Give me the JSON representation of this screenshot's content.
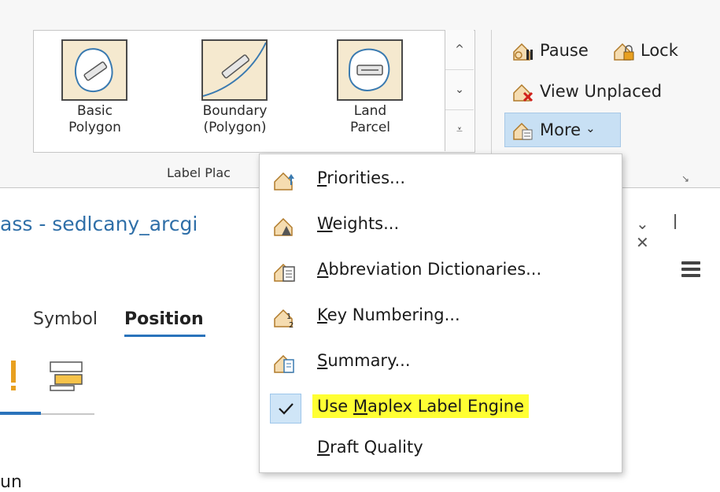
{
  "ribbon": {
    "gallery": [
      {
        "line1": "Basic",
        "line2": "Polygon"
      },
      {
        "line1": "Boundary",
        "line2": "(Polygon)"
      },
      {
        "line1": "Land",
        "line2": "Parcel"
      }
    ],
    "scroll_up": "^",
    "scroll_down": "⌄",
    "scroll_expand": "⩡",
    "group_label": "Label Plac",
    "pause_label": "Pause",
    "lock_label": "Lock",
    "view_unplaced_label": "View Unplaced",
    "more_label": "More",
    "more_caret": "⌄",
    "launcher": "↘"
  },
  "pane": {
    "title": "ass - sedlcany_arcgi",
    "controls": "⌄ ꟾ ✕",
    "tab_symbol": "Symbol",
    "tab_position": "Position",
    "bottom_text": "un"
  },
  "menu": {
    "items": [
      {
        "pre": "",
        "key": "P",
        "post": "riorities..."
      },
      {
        "pre": "",
        "key": "W",
        "post": "eights..."
      },
      {
        "pre": "",
        "key": "A",
        "post": "bbreviation Dictionaries..."
      },
      {
        "pre": "",
        "key": "K",
        "post": "ey Numbering..."
      },
      {
        "pre": "",
        "key": "S",
        "post": "ummary..."
      },
      {
        "pre": "Use ",
        "key": "M",
        "post": "aplex Label Engine",
        "checked": true,
        "highlight_color": "#ffff33"
      },
      {
        "pre": "",
        "key": "D",
        "post": "raft Quality"
      }
    ],
    "check_mark": "✓"
  },
  "colors": {
    "accent": "#2a73bb",
    "more_bg": "#c8e0f4",
    "highlight": "#ffff33",
    "tile_fill": "#f5e9cf"
  }
}
